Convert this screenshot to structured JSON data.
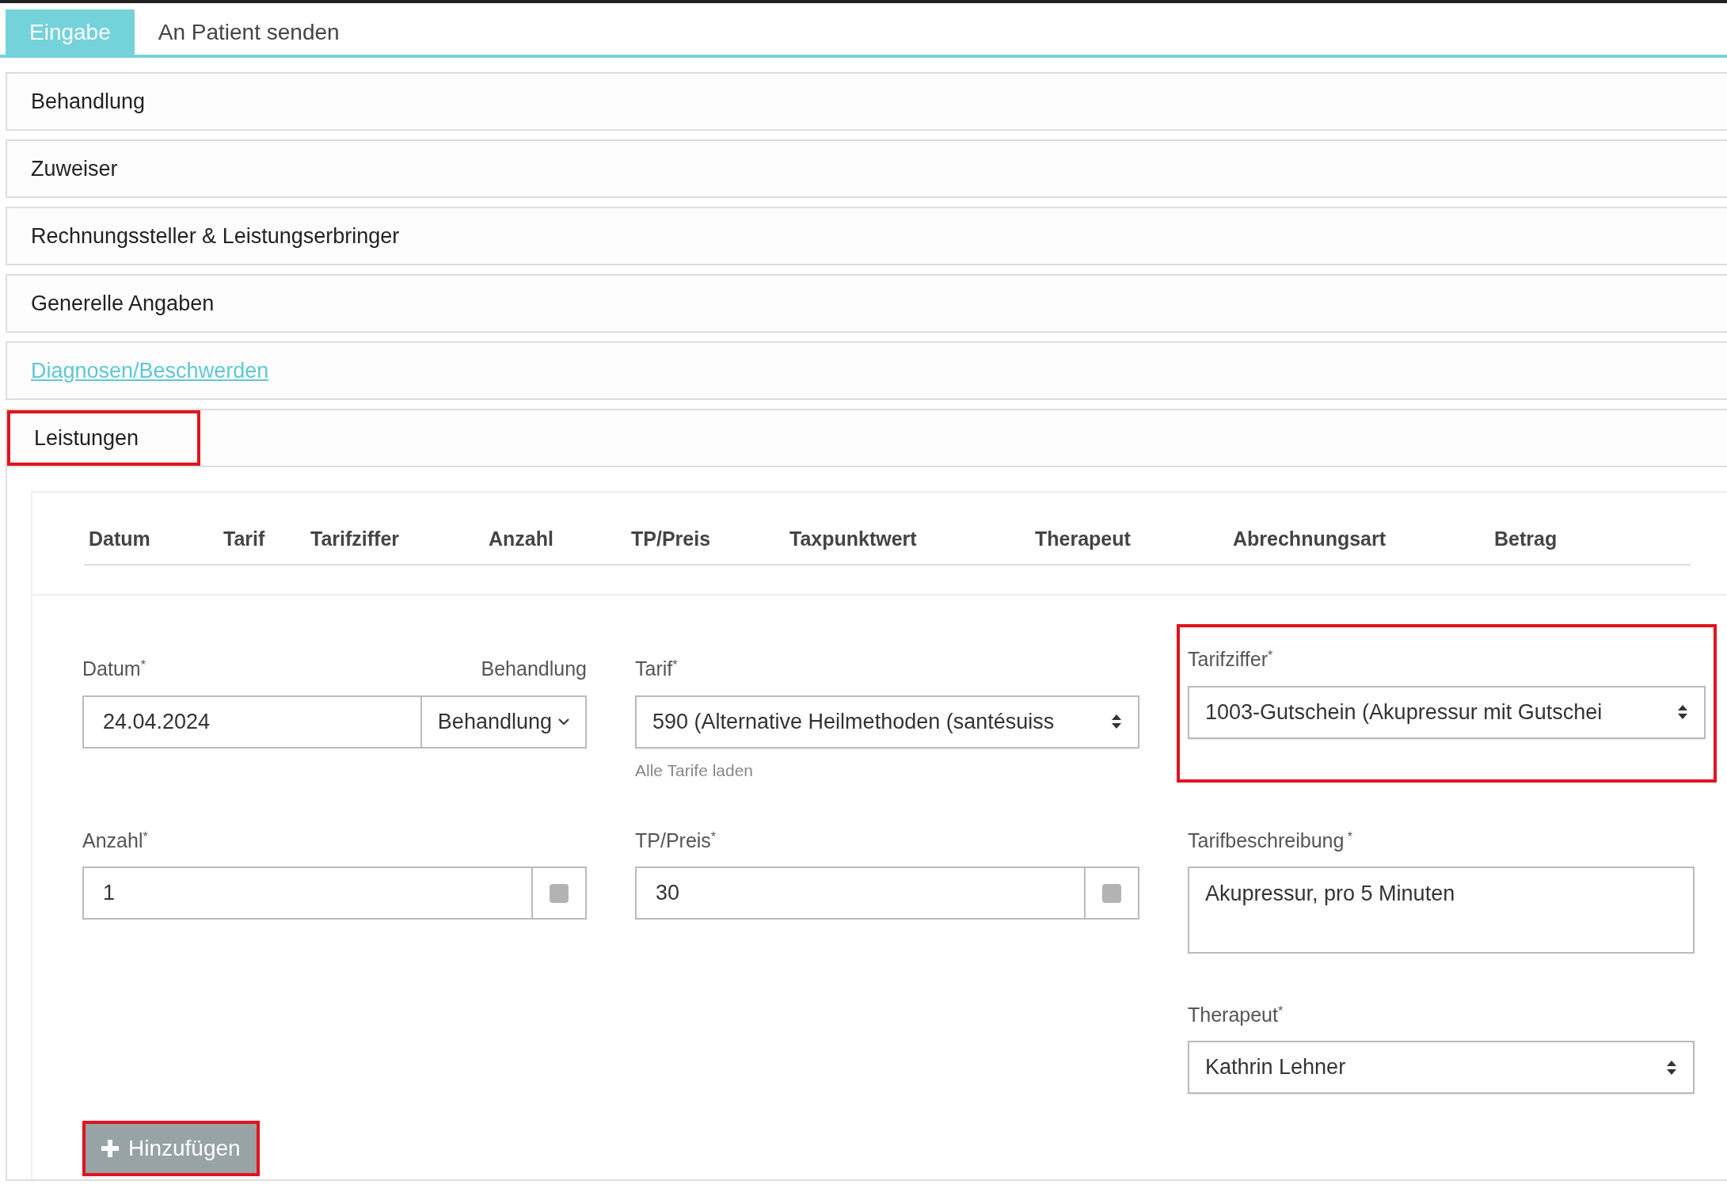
{
  "tabs": [
    {
      "label": "Eingabe",
      "selected": true
    },
    {
      "label": "An Patient senden",
      "selected": false
    }
  ],
  "sections": [
    {
      "title": "Behandlung",
      "kind": "plain",
      "highlighted": false
    },
    {
      "title": "Zuweiser",
      "kind": "plain",
      "highlighted": false
    },
    {
      "title": "Rechnungssteller & Leistungserbringer",
      "kind": "plain",
      "highlighted": false
    },
    {
      "title": "Generelle Angaben",
      "kind": "plain",
      "highlighted": false
    },
    {
      "title": "Diagnosen/Beschwerden",
      "kind": "link",
      "highlighted": false
    },
    {
      "title": "Leistungen",
      "kind": "plain",
      "highlighted": true
    }
  ],
  "table": {
    "columns": [
      "Datum",
      "Tarif",
      "Tarifziffer",
      "Anzahl",
      "TP/Preis",
      "Taxpunktwert",
      "Therapeut",
      "Abrechnungsart",
      "Betrag"
    ]
  },
  "form": {
    "datum": {
      "label": "Datum",
      "required": "*",
      "value": "24.04.2024",
      "side_label": "Behandlung",
      "dropdown": "Behandlung"
    },
    "tarif": {
      "label": "Tarif",
      "required": "*",
      "value": "590 (Alternative Heilmethoden (santésuiss",
      "help": "Alle Tarife laden"
    },
    "tarifziffer": {
      "label": "Tarifziffer",
      "required": "*",
      "value": "1003-Gutschein (Akupressur mit Gutschei",
      "highlighted": true
    },
    "anzahl": {
      "label": "Anzahl",
      "required": "*",
      "value": "1",
      "checked": false
    },
    "tp_preis": {
      "label": "TP/Preis",
      "required": "*",
      "value": "30",
      "checked": false
    },
    "tarifbeschreibung": {
      "label": "Tarifbeschreibung",
      "required": " *",
      "value": "Akupressur, pro 5 Minuten"
    },
    "therapeut": {
      "label": "Therapeut",
      "required": "*",
      "value": "Kathrin Lehner"
    }
  },
  "add_button": {
    "label": "Hinzufügen",
    "highlighted": true
  }
}
